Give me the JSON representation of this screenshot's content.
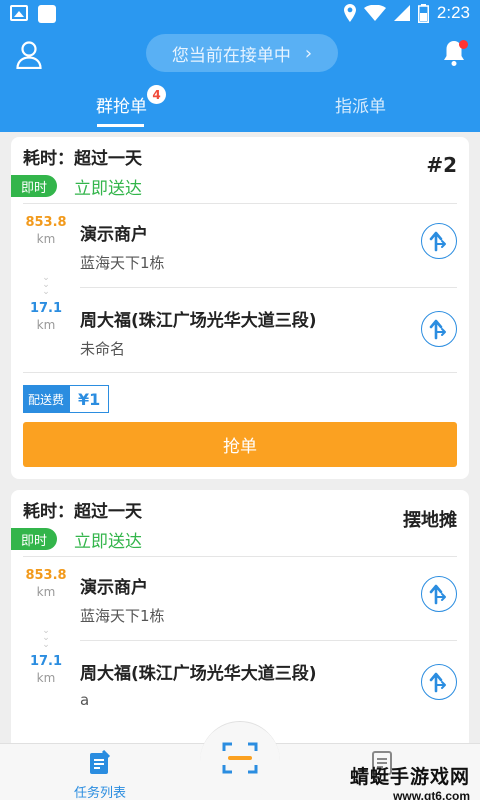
{
  "status_bar": {
    "time": "2:23"
  },
  "header": {
    "pill_text": "您当前在接单中",
    "tabs": [
      {
        "label": "群抢单",
        "badge": "4",
        "active": true
      },
      {
        "label": "指派单",
        "active": false
      }
    ]
  },
  "orders": [
    {
      "elapsed": "耗时：超过一天",
      "tag": "#2",
      "instant_label": "即时",
      "delivery_type": "立即送达",
      "pickup": {
        "distance": "853.8",
        "unit": "km",
        "name": "演示商户",
        "address": "蓝海天下1栋"
      },
      "dropoff": {
        "distance": "17.1",
        "unit": "km",
        "name": "周大福(珠江广场光华大道三段)",
        "address": "未命名"
      },
      "fee_label": "配送费",
      "fee_value": "¥1",
      "grab_label": "抢单"
    },
    {
      "elapsed": "耗时：超过一天",
      "tag": "摆地摊",
      "instant_label": "即时",
      "delivery_type": "立即送达",
      "pickup": {
        "distance": "853.8",
        "unit": "km",
        "name": "演示商户",
        "address": "蓝海天下1栋"
      },
      "dropoff": {
        "distance": "17.1",
        "unit": "km",
        "name": "周大福(珠江广场光华大道三段)",
        "address": "a"
      }
    }
  ],
  "bottom_nav": {
    "tasks_label": "任务列表"
  },
  "watermark": {
    "title": "蜻蜓手游戏网",
    "url": "www.qt6.com"
  },
  "colors": {
    "primary": "#2b98f0",
    "accent_green": "#33b54b",
    "accent_orange": "#fba121",
    "pickup_distance": "#f29a1c",
    "drop_distance": "#2b8de0"
  }
}
